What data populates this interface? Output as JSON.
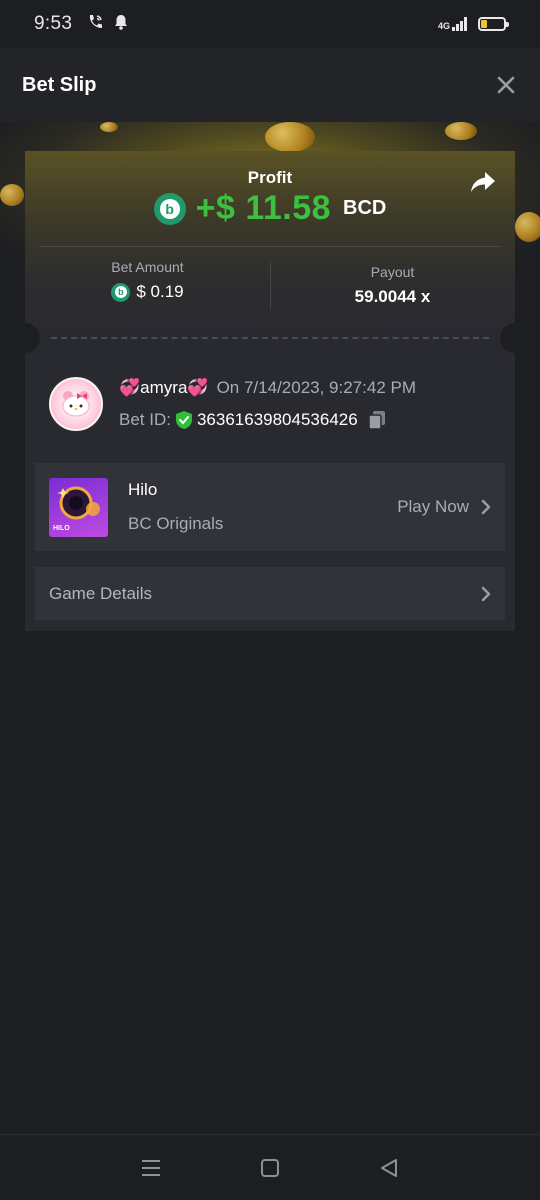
{
  "status": {
    "time": "9:53",
    "network": "4G"
  },
  "header": {
    "title": "Bet Slip"
  },
  "profit": {
    "label": "Profit",
    "amount": "+$ 11.58",
    "currency": "BCD",
    "coin_letter": "b"
  },
  "bet": {
    "amount_label": "Bet Amount",
    "amount_value": "$ 0.19",
    "payout_label": "Payout",
    "payout_value": "59.0044 x"
  },
  "user": {
    "name": "💞amyra💞",
    "date": "On 7/14/2023, 9:27:42 PM",
    "bet_id_label": "Bet ID:",
    "bet_id": "36361639804536426"
  },
  "game": {
    "name": "Hilo",
    "provider": "BC Originals",
    "play_label": "Play Now",
    "thumb_label": "HILO"
  },
  "details": {
    "label": "Game Details"
  },
  "colors": {
    "profit_green": "#3dc040",
    "coin_green": "#1f9a6d",
    "background": "#1d1e22"
  },
  "icons": {
    "close": "close-icon",
    "share": "share-icon",
    "copy": "copy-icon",
    "shield": "shield-check-icon",
    "chevron": "chevron-right-icon",
    "nav_menu": "menu-icon",
    "nav_home": "home-square-icon",
    "nav_back": "back-triangle-icon"
  }
}
